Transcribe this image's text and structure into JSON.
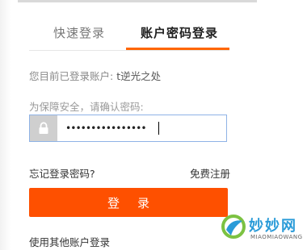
{
  "tabs": [
    {
      "label": "快速登录",
      "active": false
    },
    {
      "label": "账户密码登录",
      "active": true
    }
  ],
  "accent_color": "#fe5000",
  "current_account": {
    "prefix": "您目前已登录账户: ",
    "username": "t逆光之处"
  },
  "password_hint": "为保障安全，请确认密码:",
  "password": {
    "masked_value": "••••••••••••••••",
    "icon": "lock-icon"
  },
  "links": {
    "forgot": "忘记登录密码?",
    "register": "免费注册",
    "other": "使用其他账户登录"
  },
  "login_button": "登录",
  "watermark": {
    "cn": "妙妙网",
    "en": "MIAOMIAOWANG"
  }
}
